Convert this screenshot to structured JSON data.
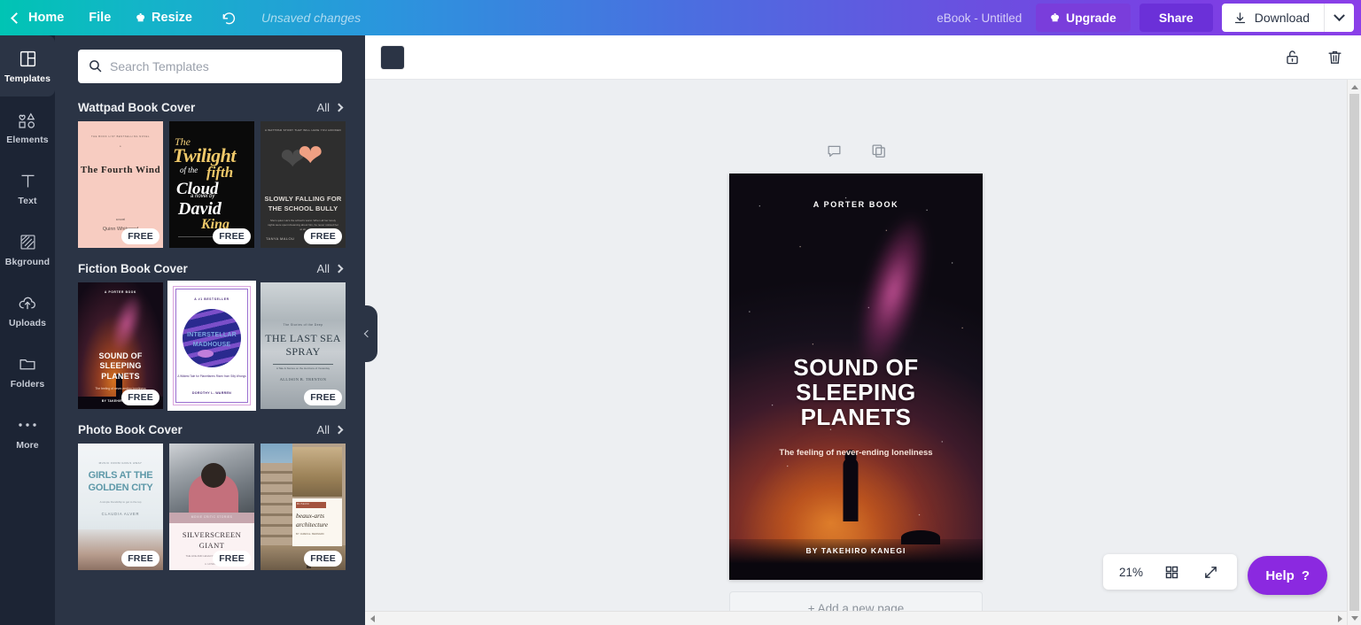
{
  "topbar": {
    "back_icon": "chevron-left-icon",
    "home_label": "Home",
    "file_label": "File",
    "resize_label": "Resize",
    "resize_crown_icon": "crown-icon",
    "undo_icon": "undo-arrow-icon",
    "unsaved_label": "Unsaved changes",
    "doc_title": "eBook - Untitled",
    "upgrade_label": "Upgrade",
    "upgrade_crown_icon": "crown-icon",
    "share_label": "Share",
    "download_label": "Download",
    "download_icon": "download-arrow-icon",
    "download_caret_icon": "chevron-down-icon",
    "gradient_start": "#00c4b4",
    "gradient_end": "#8b3fe8",
    "upgrade_color": "#7a3ddb",
    "share_color": "#6b30d8"
  },
  "rail": {
    "items": [
      {
        "label": "Templates",
        "icon": "templates-grid-icon",
        "active": true
      },
      {
        "label": "Elements",
        "icon": "elements-shapes-icon",
        "active": false
      },
      {
        "label": "Text",
        "icon": "text-t-icon",
        "active": false
      },
      {
        "label": "Bkground",
        "icon": "background-hatch-icon",
        "active": false
      },
      {
        "label": "Uploads",
        "icon": "upload-cloud-icon",
        "active": false
      },
      {
        "label": "Folders",
        "icon": "folder-icon",
        "active": false
      },
      {
        "label": "More",
        "icon": "more-dots-icon",
        "active": false
      }
    ]
  },
  "panel": {
    "search": {
      "icon": "search-icon",
      "placeholder": "Search Templates",
      "value": ""
    },
    "all_label": "All",
    "all_chevron_icon": "chevron-right-icon",
    "free_badge": "FREE",
    "collapse_icon": "chevron-left-icon",
    "sections": [
      {
        "title": "Wattpad Book Cover",
        "templates": [
          {
            "name": "the-fourth-wind",
            "kicker": "THE BOOK LIST BESTSELLING NOVEL",
            "mid": "a",
            "title": "The Fourth Wind",
            "author_label": "a novel",
            "author": "Quinn Whitwood",
            "free": true
          },
          {
            "name": "the-twilight-of-the-fifth-cloud",
            "l1": "The",
            "l2": "Twilight",
            "l3": "of the",
            "l4": "fifth",
            "l5": "Cloud",
            "l6": "a novel by",
            "l7": "David",
            "l8": "King",
            "free": true
          },
          {
            "name": "slowly-falling-for-the-school-bully",
            "kicker": "A WATTPAD STORY THAT WILL HAVE YOU HOOKED",
            "title": "SLOWLY FALLING FOR THE SCHOOL BULLY",
            "desc": "She's quiet. He's the school's worst. When all her lonely nights were spent dreaming about him, he never noticed her at all.",
            "author": "TANYA MALOU",
            "free": true
          }
        ]
      },
      {
        "title": "Fiction Book Cover",
        "templates": [
          {
            "name": "sound-of-sleeping-planets",
            "kicker": "A PORTER BOOK",
            "title": "SOUND OF SLEEPING PLANETS",
            "sub": "The feeling of never-ending loneliness",
            "author": "BY TAKEHIRO KANEGI",
            "free": true,
            "selected": false
          },
          {
            "name": "interstellar-madhouse",
            "kicker": "A #1 BESTSELLER",
            "title": "INTERSTELLAR MADHOUSE",
            "desc": "A Wildest Tale for Planetfarers Risen from Silly Wrongs",
            "author": "DOROTHY L. WARREN",
            "free": false,
            "selected": true
          },
          {
            "name": "the-last-sea-spray",
            "kicker": "The Stories of the Deep",
            "title": "THE LAST SEA SPRAY",
            "desc": "A Tale & Stories on the Horizons of Yesterday",
            "author": "ALLISON B. TRENTON",
            "free": true,
            "selected": false
          }
        ]
      },
      {
        "title": "Photo Book Cover",
        "templates": [
          {
            "name": "girls-at-the-golden-city",
            "kicker": "MUSIC FROM GIRLS AWAY",
            "title": "GIRLS AT THE GOLDEN CITY",
            "sub": "A simple friendship to get to the top",
            "author": "CLAUDIA ALVER",
            "free": true
          },
          {
            "name": "silverscreen-giant",
            "band": "MOVIE CRITIC STORIES",
            "title": "SILVERSCREEN GIANT",
            "desc": "THE LIFE AND LEGACY OF A SILENT ACTOR",
            "author": "A. HOWARD",
            "free": true
          },
          {
            "name": "beaux-arts-architecture",
            "tag": "MUSEUM",
            "title": "beaux-arts architecture",
            "author": "BY JAMES E. BERNARD",
            "free": true
          }
        ]
      }
    ]
  },
  "canvas": {
    "toolbar": {
      "color_swatch": "#2b3445",
      "color_swatch_name": "color-swatch",
      "lock_icon": "unlock-icon",
      "delete_icon": "trash-icon"
    },
    "page_tools": {
      "comment_icon": "comment-bubble-icon",
      "duplicate_icon": "duplicate-page-icon"
    },
    "design": {
      "top_label": "A PORTER BOOK",
      "title_line1": "SOUND OF",
      "title_line2": "SLEEPING",
      "title_line3": "PLANETS",
      "subtitle": "The feeling of never-ending loneliness",
      "byline": "BY TAKEHIRO KANEGI"
    },
    "add_page_label": "+ Add a new page",
    "zoom": {
      "level": "21%",
      "grid_icon": "grid-pages-icon",
      "fullscreen_icon": "expand-arrows-icon"
    },
    "help": {
      "label": "Help",
      "question_icon": "question-mark-icon",
      "color": "#8b29e0"
    }
  }
}
